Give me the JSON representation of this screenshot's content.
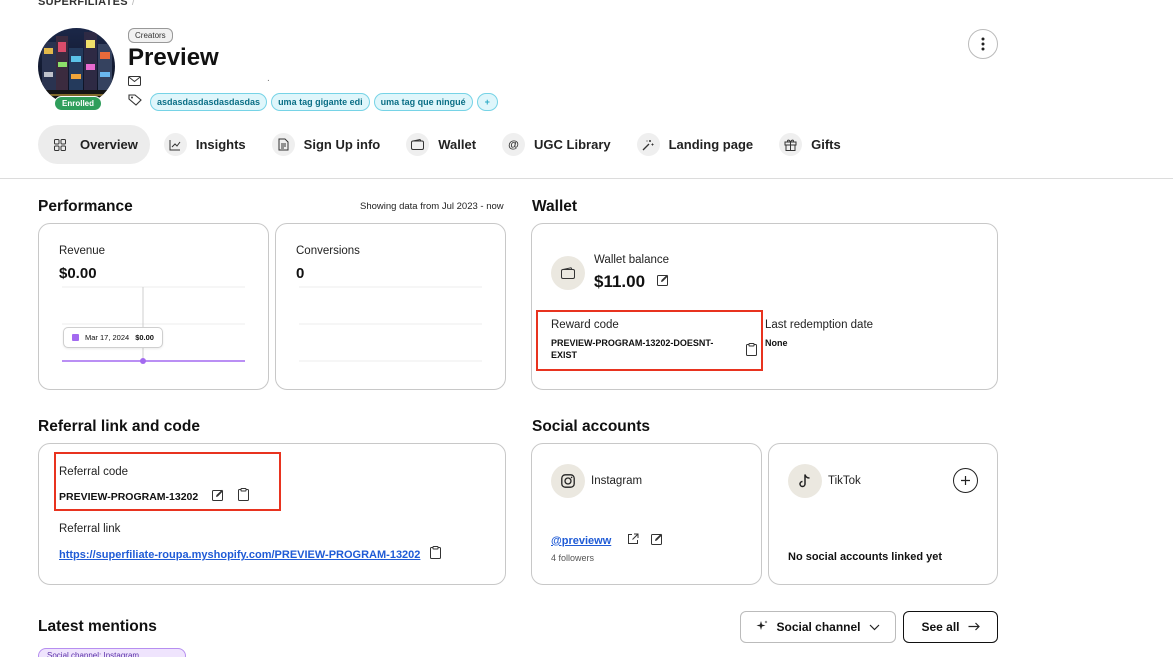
{
  "brand": "SUPERFILIATES",
  "profile": {
    "badge": "Enrolled",
    "type_chip": "Creators",
    "name": "Preview",
    "email": ".",
    "tags": [
      "asdasdasdasdasdasdas",
      "uma tag gigante edi",
      "uma tag que ningué"
    ],
    "add_tag": "+"
  },
  "tabs": [
    {
      "label": "Overview",
      "icon": "grid-icon",
      "active": true
    },
    {
      "label": "Insights",
      "icon": "chart-icon"
    },
    {
      "label": "Sign Up info",
      "icon": "document-icon"
    },
    {
      "label": "Wallet",
      "icon": "wallet-icon"
    },
    {
      "label": "UGC Library",
      "icon": "at-icon"
    },
    {
      "label": "Landing page",
      "icon": "wand-icon"
    },
    {
      "label": "Gifts",
      "icon": "gift-icon"
    }
  ],
  "performance": {
    "title": "Performance",
    "range": "Showing data from Jul 2023 - now",
    "revenue_label": "Revenue",
    "revenue_value": "$0.00",
    "conversions_label": "Conversions",
    "conversions_value": "0",
    "tooltip_date": "Mar 17, 2024",
    "tooltip_value": "$0.00"
  },
  "wallet": {
    "title": "Wallet",
    "balance_label": "Wallet balance",
    "balance_value": "$11.00",
    "reward_label": "Reward code",
    "reward_code": "PREVIEW-PROGRAM-13202-DOESNT-EXIST",
    "last_redemption_label": "Last redemption date",
    "last_redemption_value": "None"
  },
  "referral": {
    "title": "Referral link and code",
    "code_label": "Referral code",
    "code_value": "PREVIEW-PROGRAM-13202",
    "link_label": "Referral link",
    "link_value": "https://superfiliate-roupa.myshopify.com/PREVIEW-PROGRAM-13202"
  },
  "social": {
    "title": "Social accounts",
    "instagram_label": "Instagram",
    "instagram_handle": "@previeww",
    "instagram_followers": "4 followers",
    "tiktok_label": "TikTok",
    "tiktok_empty": "No social accounts linked yet"
  },
  "mentions": {
    "title": "Latest mentions",
    "channel_button": "Social channel",
    "see_all_button": "See all",
    "filter_pill": "Social channel: Instagram"
  },
  "colors": {
    "accent_purple": "#a36af0",
    "enrolled_green": "#2f9e5b",
    "highlight_red": "#e8331f",
    "link_blue": "#1f5bd6",
    "tag_cyan": "#76d3e6"
  }
}
